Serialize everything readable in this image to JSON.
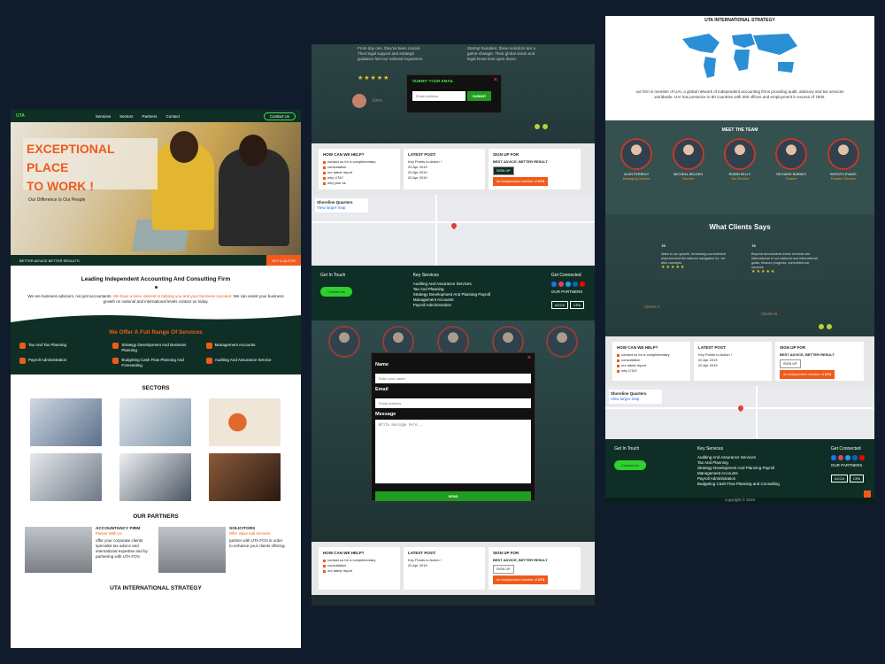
{
  "site": {
    "logo": "UTA",
    "nav": [
      "Services",
      "Sectors",
      "Partners",
      "Contact"
    ],
    "nav_cta": "Contact Us"
  },
  "hero": {
    "title_line1": "EXCEPTIONAL PLACE",
    "title_line2": "TO WORK !",
    "subtitle": "Our Difference Is Our People",
    "strip_text": "BETTER ADVICE BETTER RESULTS",
    "strip_cta": "GET A QUOTE"
  },
  "intro": {
    "heading": "Leading Independent Accounting And Consulting Firm",
    "body_a": "We are business advisors, not just accountants.",
    "body_highlight": "We have a keen interest in helping you and your business succeed.",
    "body_b": "We can assist your business growth on national and international levels contact us today."
  },
  "services": {
    "heading": "We Offer A Full Range Of Services",
    "items": [
      "Tax And Tax Planning",
      "Strategy Development And Business Planning",
      "Management Accounts",
      "Payroll Administration",
      "Budgeting Cash Flow Planning And Forecasting",
      "Auditing And Assurance Service"
    ]
  },
  "sectors": {
    "heading": "SECTORS"
  },
  "partners": {
    "heading": "OUR PARTNERS",
    "items": [
      {
        "title": "ACCOUNTANCY FIRM",
        "subtitle": "Partner With Us",
        "body": "offer your corporate clients specialist tax advice and international expertise and by partnering with UTA FCN"
      },
      {
        "title": "SOLICITORS",
        "subtitle": "Offer Value Add Services",
        "body": "partner with UTA FCN in order to enhance your clients offering."
      }
    ]
  },
  "intl": {
    "heading": "UTA INTERNATIONAL STRATEGY",
    "body": "our firm is member of UAI, a global network of independent accounting firms providing audit, advisory and tax services worldwide. UAI has presence in 80 countries with 300 offices and employment in excess of 7500."
  },
  "newsletter_modal": {
    "title": "SUBMIT YOUR EMAIL",
    "placeholder": "Email address",
    "button": "SUBMIT"
  },
  "contact_modal": {
    "name_label": "Name",
    "name_placeholder": "Enter your name",
    "email_label": "Email",
    "email_placeholder": "Email address",
    "message_label": "Message",
    "message_placeholder": "Write message here...",
    "button": "SEND"
  },
  "info": {
    "help_title": "HOW CAN WE HELP?",
    "help_items": [
      "contact us for a complimentary",
      "consultation",
      "our latest report",
      "why UTA?",
      "why pick us"
    ],
    "post_title": "LATEST POST:",
    "post_items": [
      "Key Points to Action !",
      "20 Apr 2019",
      "20 Apr 2019",
      "20 Apr 2019",
      "20 Apr 2019"
    ],
    "signup_title": "SIGN UP FOR",
    "signup_sub": "BEST ADVICE, BETTER RESULT",
    "signup_btn": "SIGN UP",
    "member_text": "An independent member of",
    "member_badge": "UTA"
  },
  "map": {
    "place": "Shoreline Quarters",
    "link": "View larger map"
  },
  "footer": {
    "touch": "Get In Touch",
    "touch_btn": "Contact Us",
    "key_title": "Key Services",
    "key_items": [
      "Auditing And Assurance Services",
      "Tax And Planning",
      "Strategy Development And Planning Payroll",
      "Management Accounts",
      "Payroll Administration",
      "Budgeting Cash Flow Planning and Consulting"
    ],
    "connect": "Get Connected",
    "partners_label": "OUR PARTNERS",
    "badges": [
      "ACCA",
      "CPA"
    ],
    "copyright": "copyright © 2019"
  },
  "team": {
    "heading": "MEET THE TEAM",
    "members": [
      {
        "name": "ALEN FERRELY",
        "role": "Managing Director"
      },
      {
        "name": "MICHEAL BELDEN",
        "role": "Director"
      },
      {
        "name": "ROBIN KELLY",
        "role": "Tax Director"
      },
      {
        "name": "RICHARD BARNEY",
        "role": "Partner"
      },
      {
        "name": "KEROTH EVANS",
        "role": "Practice Director"
      }
    ]
  },
  "clients": {
    "heading": "What Clients Says",
    "quotes": [
      {
        "text": "Want to our growth, increasing commitment improvement the tailored navigation for, we also concepts",
        "author": "Clients A"
      },
      {
        "text": "Beyond accountants these services are international in our national and international goals, finance progress, committed our success",
        "author": "Clients B"
      }
    ]
  },
  "testimonial_top": {
    "text_a": "From day one, they've been crucial. Their legal support and strategic guidance fuel our national expansion.",
    "text_b": "Startup founders, these solicitors are a game-changer. Their global vision and legal know-how open doors.",
    "author": "John"
  },
  "colors": {
    "dark_green": "#0f2f26",
    "accent": "#f05a1a",
    "green": "#2ed12e"
  }
}
